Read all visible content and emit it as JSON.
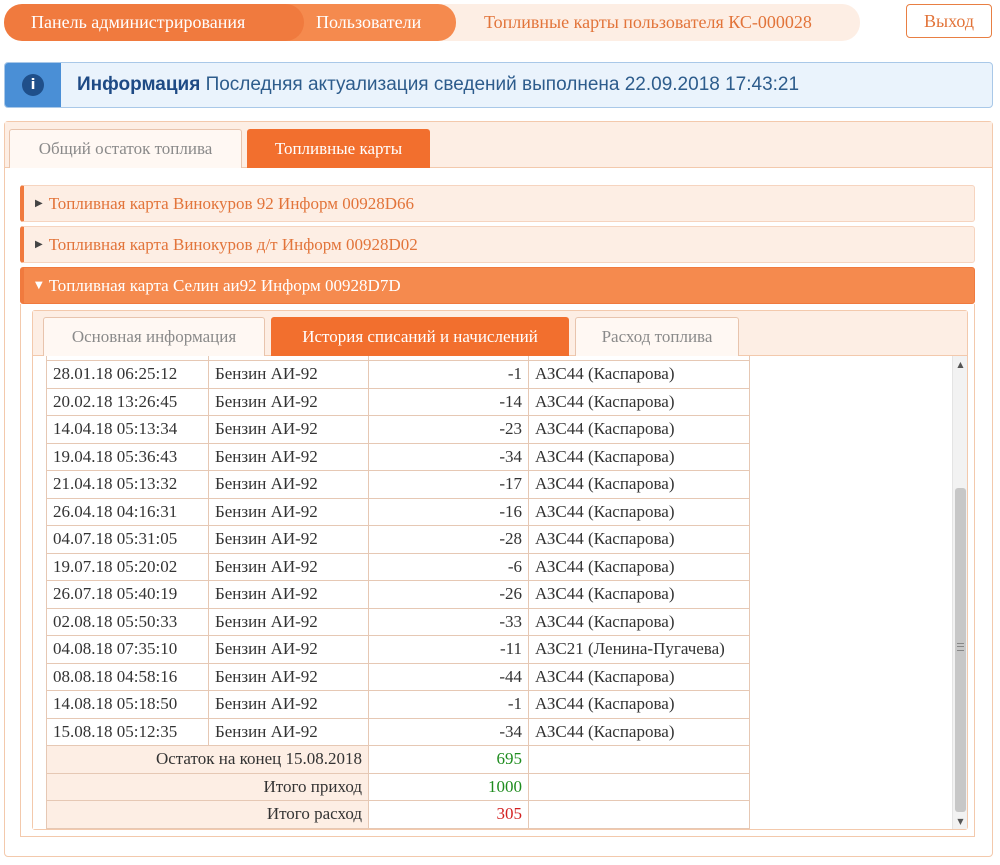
{
  "breadcrumb": {
    "items": [
      {
        "label": "Панель администрирования"
      },
      {
        "label": "Пользователи"
      },
      {
        "label": "Топливные карты пользователя КС-000028"
      }
    ]
  },
  "logout_label": "Выход",
  "info": {
    "icon": "info-icon",
    "title": "Информация",
    "message": "Последняя актуализация сведений выполнена 22.09.2018 17:43:21"
  },
  "tabs": [
    {
      "label": "Общий остаток топлива",
      "active": false
    },
    {
      "label": "Топливные карты",
      "active": true
    }
  ],
  "cards": [
    {
      "label": "Топливная карта Винокуров 92 Информ 00928D66",
      "expanded": false
    },
    {
      "label": "Топливная карта Винокуров д/т Информ 00928D02",
      "expanded": false
    },
    {
      "label": "Топливная карта Селин аи92 Информ 00928D7D",
      "expanded": true
    }
  ],
  "subtabs": [
    {
      "label": "Основная информация",
      "active": false
    },
    {
      "label": "История списаний и начислений",
      "active": true
    },
    {
      "label": "Расход топлива",
      "active": false
    }
  ],
  "transactions": [
    {
      "date": "28.01.18 06:25:12",
      "fuel": "Бензин АИ-92",
      "amount": "-1",
      "station": "АЗС44 (Каспарова)"
    },
    {
      "date": "20.02.18 13:26:45",
      "fuel": "Бензин АИ-92",
      "amount": "-14",
      "station": "АЗС44 (Каспарова)"
    },
    {
      "date": "14.04.18 05:13:34",
      "fuel": "Бензин АИ-92",
      "amount": "-23",
      "station": "АЗС44 (Каспарова)"
    },
    {
      "date": "19.04.18 05:36:43",
      "fuel": "Бензин АИ-92",
      "amount": "-34",
      "station": "АЗС44 (Каспарова)"
    },
    {
      "date": "21.04.18 05:13:32",
      "fuel": "Бензин АИ-92",
      "amount": "-17",
      "station": "АЗС44 (Каспарова)"
    },
    {
      "date": "26.04.18 04:16:31",
      "fuel": "Бензин АИ-92",
      "amount": "-16",
      "station": "АЗС44 (Каспарова)"
    },
    {
      "date": "04.07.18 05:31:05",
      "fuel": "Бензин АИ-92",
      "amount": "-28",
      "station": "АЗС44 (Каспарова)"
    },
    {
      "date": "19.07.18 05:20:02",
      "fuel": "Бензин АИ-92",
      "amount": "-6",
      "station": "АЗС44 (Каспарова)"
    },
    {
      "date": "26.07.18 05:40:19",
      "fuel": "Бензин АИ-92",
      "amount": "-26",
      "station": "АЗС44 (Каспарова)"
    },
    {
      "date": "02.08.18 05:50:33",
      "fuel": "Бензин АИ-92",
      "amount": "-33",
      "station": "АЗС44 (Каспарова)"
    },
    {
      "date": "04.08.18 07:35:10",
      "fuel": "Бензин АИ-92",
      "amount": "-11",
      "station": "АЗС21 (Ленина-Пугачева)"
    },
    {
      "date": "08.08.18 04:58:16",
      "fuel": "Бензин АИ-92",
      "amount": "-44",
      "station": "АЗС44 (Каспарова)"
    },
    {
      "date": "14.08.18 05:18:50",
      "fuel": "Бензин АИ-92",
      "amount": "-1",
      "station": "АЗС44 (Каспарова)"
    },
    {
      "date": "15.08.18 05:12:35",
      "fuel": "Бензин АИ-92",
      "amount": "-34",
      "station": "АЗС44 (Каспарова)"
    }
  ],
  "summary": [
    {
      "label": "Остаток на конец 15.08.2018",
      "value": "695",
      "color": "#1e8c1e"
    },
    {
      "label": "Итого приход",
      "value": "1000",
      "color": "#1e8c1e"
    },
    {
      "label": "Итого расход",
      "value": "305",
      "color": "#d32020"
    }
  ],
  "colors": {
    "accent": "#f07a3e",
    "info_blue": "#4a8fd6",
    "negative": "#d32020",
    "positive": "#1e8c1e"
  }
}
